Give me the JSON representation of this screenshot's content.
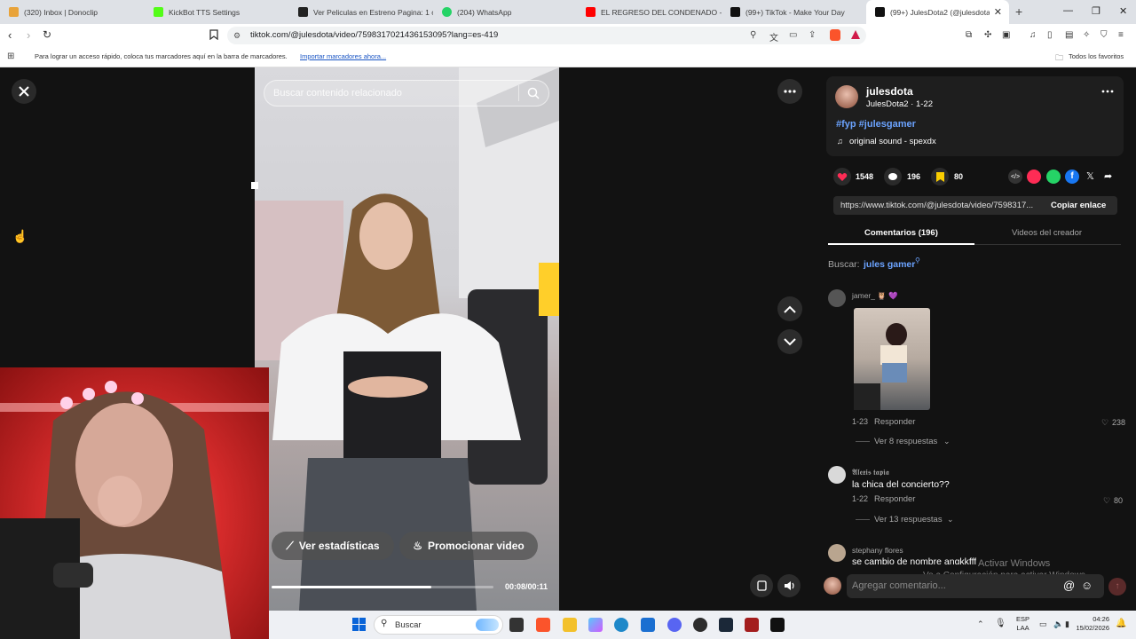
{
  "browser": {
    "tabs": [
      {
        "title": "(320) Inbox | Donoclip",
        "color": "#e8a33a",
        "active": false
      },
      {
        "title": "KickBot TTS Settings",
        "color": "#53fc18",
        "active": false
      },
      {
        "title": "Ver Peliculas en Estreno Pagina: 1 on",
        "color": "#222222",
        "active": false
      },
      {
        "title": "(204) WhatsApp",
        "color": "#25d366",
        "active": false
      },
      {
        "title": "EL REGRESO DEL CONDENADO - Yo",
        "color": "#ff0000",
        "active": false
      },
      {
        "title": "(99+) TikTok - Make Your Day",
        "color": "#111111",
        "active": false
      },
      {
        "title": "(99+) JulesDota2 (@julesdota",
        "color": "#111111",
        "active": true
      }
    ],
    "url": "tiktok.com/@julesdota/video/7598317021436153095?lang=es-419",
    "bookmarks_text": "Para lograr un acceso rápido, coloca tus marcadores aquí en la barra de marcadores.",
    "bookmarks_link": "Importar marcadores ahora...",
    "favorites_label": "Todos los favoritos"
  },
  "player": {
    "search_placeholder": "Buscar contenido relacionado",
    "stats_label": "Ver estadísticas",
    "promote_label": "Promocionar video",
    "time": "00:08/00:11",
    "progress": 0.72
  },
  "panel": {
    "username": "julesdota",
    "subtitle": "JulesDota2 · 1-22",
    "hashtags": "#fyp #julesgamer",
    "sound": "original sound - spexdx",
    "likes": "1548",
    "comments": "196",
    "saves": "80",
    "share_url": "https://www.tiktok.com/@julesdota/video/7598317...",
    "copy_label": "Copiar enlace",
    "tab_comments": "Comentarios (196)",
    "tab_creator": "Videos del creador",
    "search_prefix": "Buscar:",
    "search_term": "jules gamer",
    "comments_list": [
      {
        "user": "jamer_ 🦉 💜",
        "text": "",
        "date": "1-23",
        "reply": "Responder",
        "likes": "238",
        "more": "Ver 8 respuestas"
      },
      {
        "user": "𝕬𝖑𝖊𝖝𝖎𝖘 𝖙𝖆𝖕𝖎𝖆",
        "text": "la chica del concierto??",
        "date": "1-22",
        "reply": "Responder",
        "likes": "80",
        "more": "Ver 13 respuestas"
      },
      {
        "user": "stephany flores",
        "text": "se cambio de nombre angkkfff",
        "date": "",
        "reply": "",
        "likes": "",
        "more": ""
      }
    ],
    "compose_placeholder": "Agregar comentario...",
    "watermark_line1": "Activar Windows",
    "watermark_line2": "Ve a Configuración para activar Windows."
  },
  "taskbar": {
    "search_label": "Buscar",
    "lang1": "ESP",
    "lang2": "LAA",
    "time": "04:26",
    "date": "15/02/2026"
  },
  "colors": {
    "like": "#fe2c55",
    "save": "#facd00",
    "link": "#6ba3ff"
  }
}
